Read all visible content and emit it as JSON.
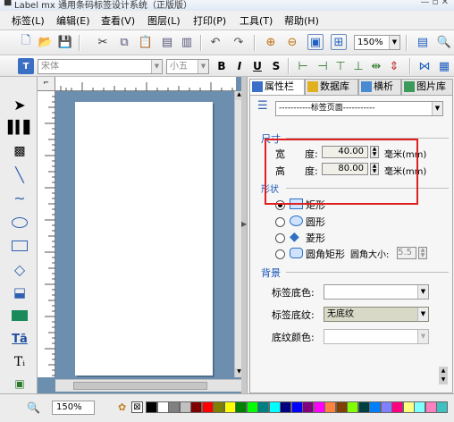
{
  "window": {
    "title": "Label mx 通用条码标签设计系统（正版版）"
  },
  "menu": [
    "标签(L)",
    "编辑(E)",
    "查看(V)",
    "图层(L)",
    "打印(P)",
    "工具(T)",
    "帮助(H)"
  ],
  "toolbar": {
    "zoom_value": "150%"
  },
  "format_bar": {
    "font": "宋体",
    "size": "小五",
    "bold": "B",
    "italic": "I",
    "underline": "U",
    "strike": "S"
  },
  "tabs": [
    "属性栏",
    "数据库",
    "横析",
    "图片库"
  ],
  "properties": {
    "template_select": "-----------标签页面-----------",
    "size_section": "尺寸",
    "width_label": "宽　　度:",
    "width_value": "40.00",
    "width_unit": "毫米(mm)",
    "height_label": "高　　度:",
    "height_value": "80.00",
    "height_unit": "毫米(mm)",
    "shape_section": "形状",
    "shapes": [
      "矩形",
      "圆形",
      "菱形",
      "圆角矩形"
    ],
    "corner_label": "圆角大小:",
    "corner_value": "5.5",
    "background_section": "背景",
    "bg_color_label": "标签底色:",
    "bg_color_value": "",
    "bg_pattern_label": "标签底纹:",
    "bg_pattern_value": "无底纹",
    "pattern_color_label": "底纹颜色:",
    "pattern_color_value": ""
  },
  "status": {
    "zoom": "150%"
  },
  "palette": [
    "#000000",
    "#ffffff",
    "#808080",
    "#c0c0c0",
    "#800000",
    "#ff0000",
    "#808000",
    "#ffff00",
    "#008000",
    "#00ff00",
    "#008080",
    "#00ffff",
    "#000080",
    "#0000ff",
    "#800080",
    "#ff00ff",
    "#ff8040",
    "#804000",
    "#80ff00",
    "#004040",
    "#0080ff",
    "#8080ff",
    "#ff0080",
    "#ffff80",
    "#80ffff",
    "#ff80c0",
    "#40c0c0"
  ],
  "colors": {
    "highlight_box": "#e02020",
    "canvas_bg": "#6d8faf",
    "accent_blue": "#1d57b8"
  }
}
